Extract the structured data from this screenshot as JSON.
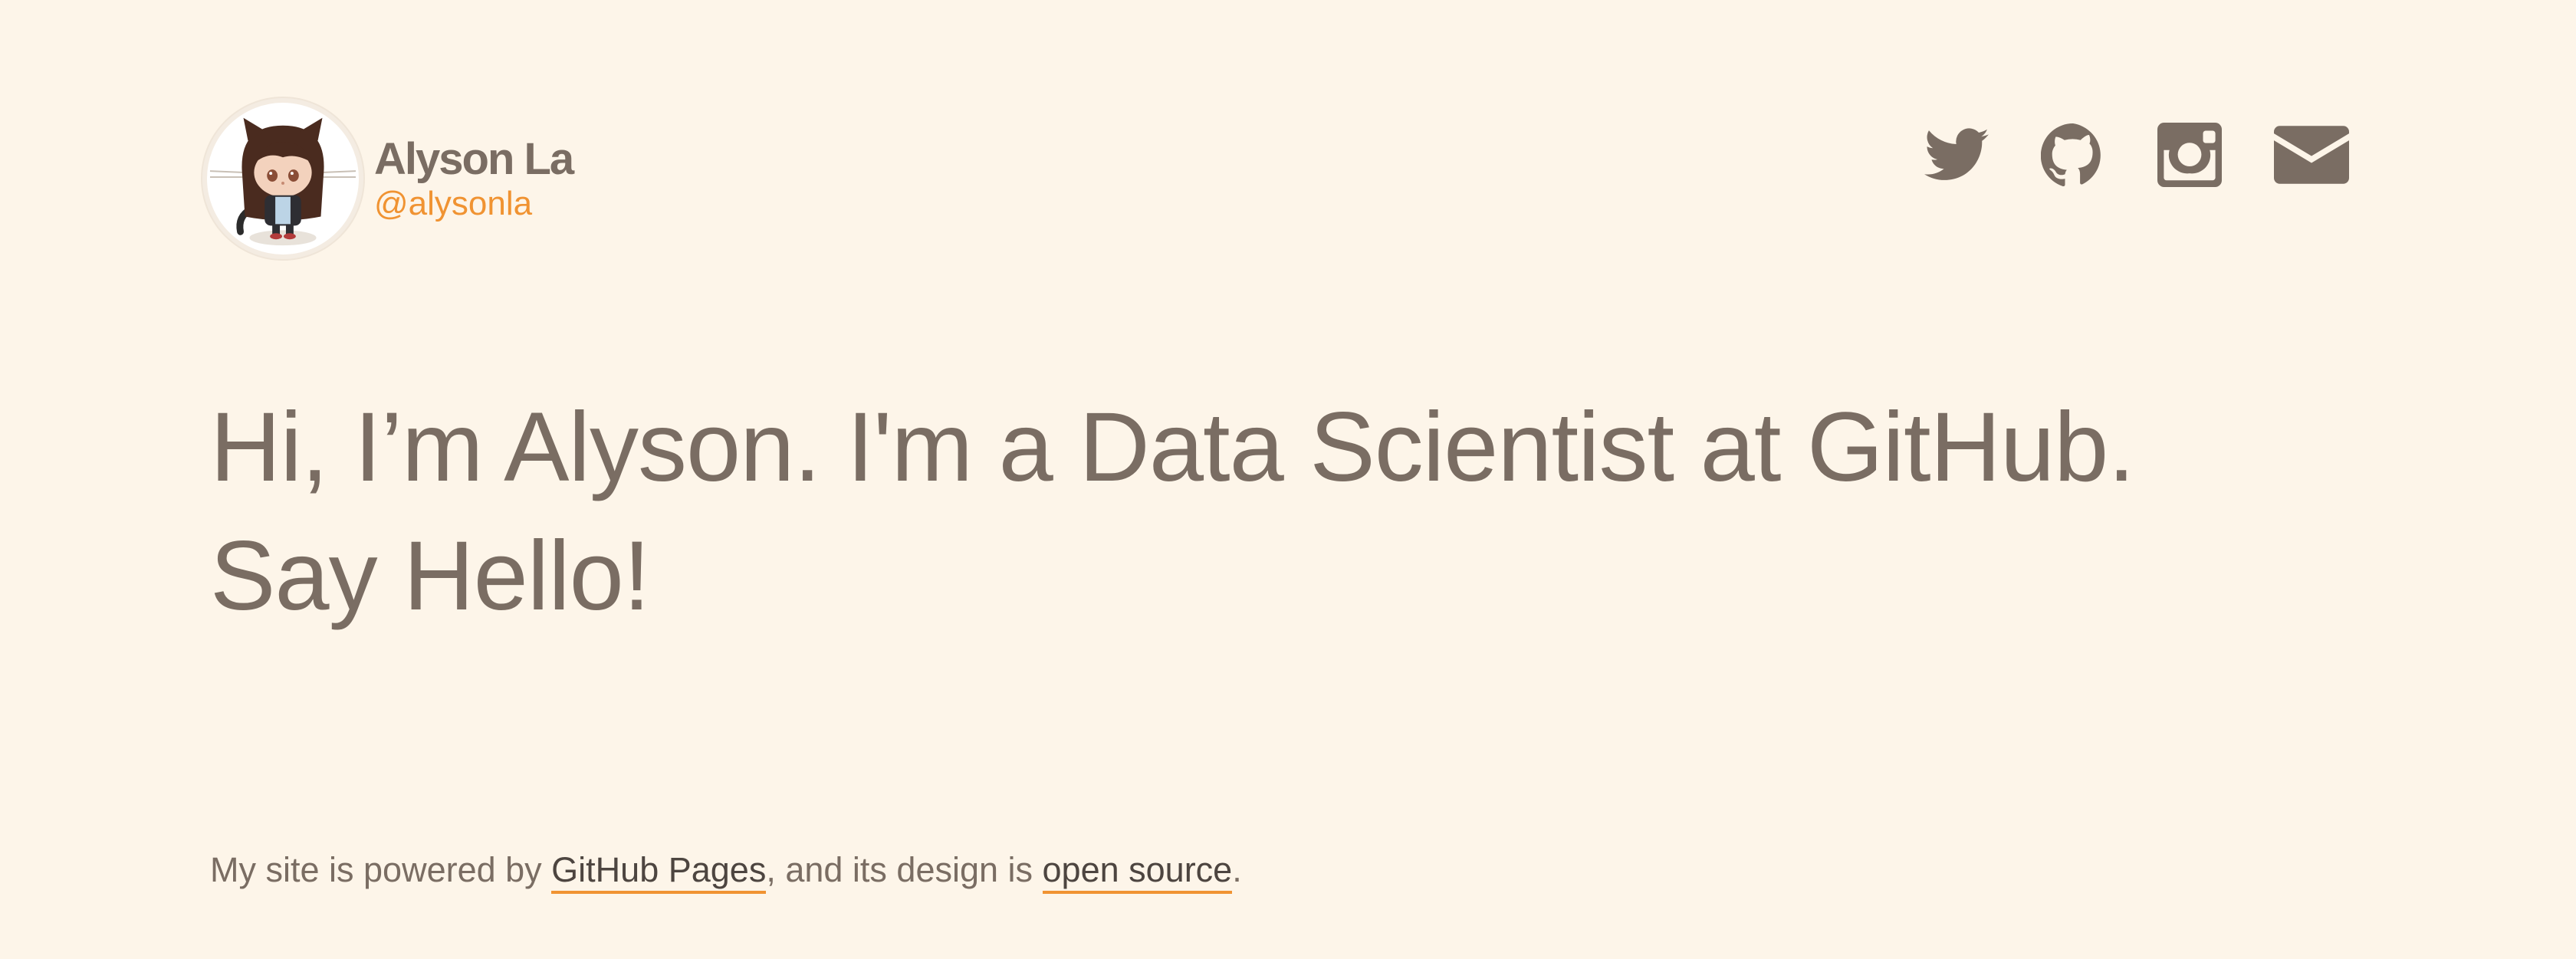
{
  "profile": {
    "name": "Alyson La",
    "handle": "@alysonla",
    "avatar_icon": "octocat-avatar-icon"
  },
  "social": [
    {
      "name": "twitter-icon",
      "label": "Twitter"
    },
    {
      "name": "github-icon",
      "label": "GitHub"
    },
    {
      "name": "instagram-icon",
      "label": "Instagram"
    },
    {
      "name": "email-icon",
      "label": "Email"
    }
  ],
  "headline": "Hi, I’m Alyson. I'm a Data Scientist at GitHub. Say Hello!",
  "footer": {
    "prefix": "My site is powered by ",
    "link1": "GitHub Pages",
    "middle": ", and its design is ",
    "link2": "open source",
    "suffix": "."
  },
  "colors": {
    "background": "#fdf5e9",
    "text": "#7a6d63",
    "accent": "#f09332",
    "link_text": "#4d4540"
  }
}
